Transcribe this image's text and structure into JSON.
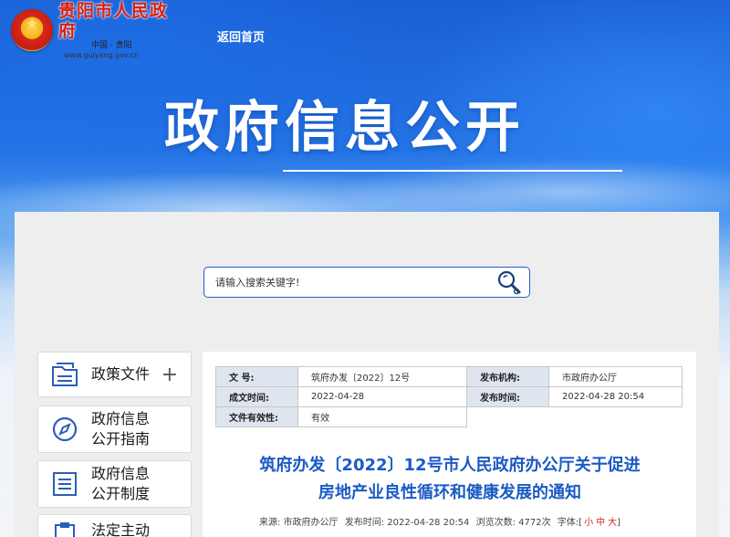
{
  "header": {
    "site_name": "贵阳市人民政府",
    "site_sub": "中国 · 贵阳",
    "site_url": "www.guiyang.gov.cn",
    "home_link": "返回首页",
    "banner_title": "政府信息公开"
  },
  "search": {
    "placeholder": "请输入搜索关键字!"
  },
  "sidebar": {
    "items": [
      {
        "label": "政策文件",
        "icon": "document-stack-icon",
        "has_plus": true
      },
      {
        "label": "政府信息\n公开指南",
        "icon": "compass-icon"
      },
      {
        "label": "政府信息\n公开制度",
        "icon": "list-document-icon"
      },
      {
        "label": "法定主动",
        "icon": "clipboard-icon"
      }
    ],
    "plus_symbol": "+"
  },
  "meta": {
    "doc_no_label": "文 号:",
    "doc_no_value": "筑府办发〔2022〕12号",
    "agency_label": "发布机构:",
    "agency_value": "市政府办公厅",
    "created_label": "成文时间:",
    "created_value": "2022-04-28",
    "published_label": "发布时间:",
    "published_value": "2022-04-28 20:54",
    "validity_label": "文件有效性:",
    "validity_value": "有效"
  },
  "article": {
    "title_line1": "筑府办发〔2022〕12号市人民政府办公厅关于促进",
    "title_line2": "房地产业良性循环和健康发展的通知",
    "source": "来源: 市政府办公厅",
    "publish_time": "发布时间: 2022-04-28 20:54",
    "views": "浏览次数: 4772次",
    "font_label": "字体:[",
    "font_small": "小",
    "font_mid": "中",
    "font_large": "大",
    "font_close": "]"
  },
  "colors": {
    "accent_blue": "#1b5ac4",
    "brand_red": "#d81e14"
  }
}
